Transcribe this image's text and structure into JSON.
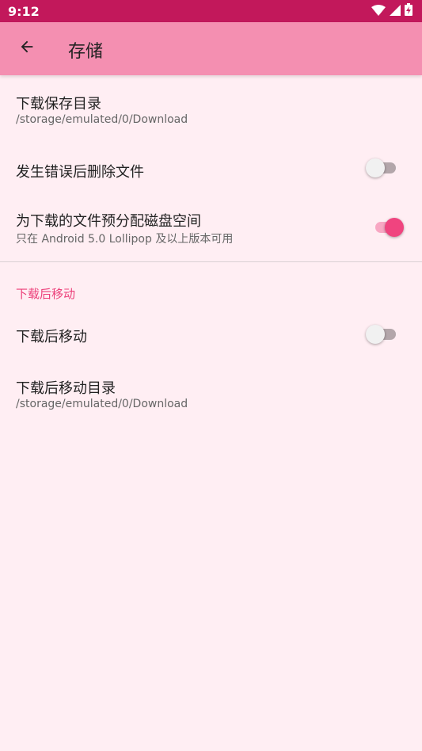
{
  "status_bar": {
    "time": "9:12"
  },
  "app_bar": {
    "title": "存储",
    "back_icon": "arrow-back-icon"
  },
  "prefs": {
    "download_dir": {
      "title": "下载保存目录",
      "summary": "/storage/emulated/0/Download"
    },
    "delete_on_error": {
      "title": "发生错误后删除文件",
      "enabled": false
    },
    "preallocate": {
      "title": "为下载的文件预分配磁盘空间",
      "summary": "只在 Android 5.0 Lollipop 及以上版本可用",
      "enabled": true
    }
  },
  "move_section": {
    "category": "下载后移动",
    "move_after": {
      "title": "下载后移动",
      "enabled": false
    },
    "move_dir": {
      "title": "下载后移动目录",
      "summary": "/storage/emulated/0/Download"
    }
  },
  "colors": {
    "status_bar": "#c2185b",
    "app_bar": "#f48fb1",
    "background": "#ffeef3",
    "accent": "#f0447f",
    "category_text": "#ec407a"
  }
}
